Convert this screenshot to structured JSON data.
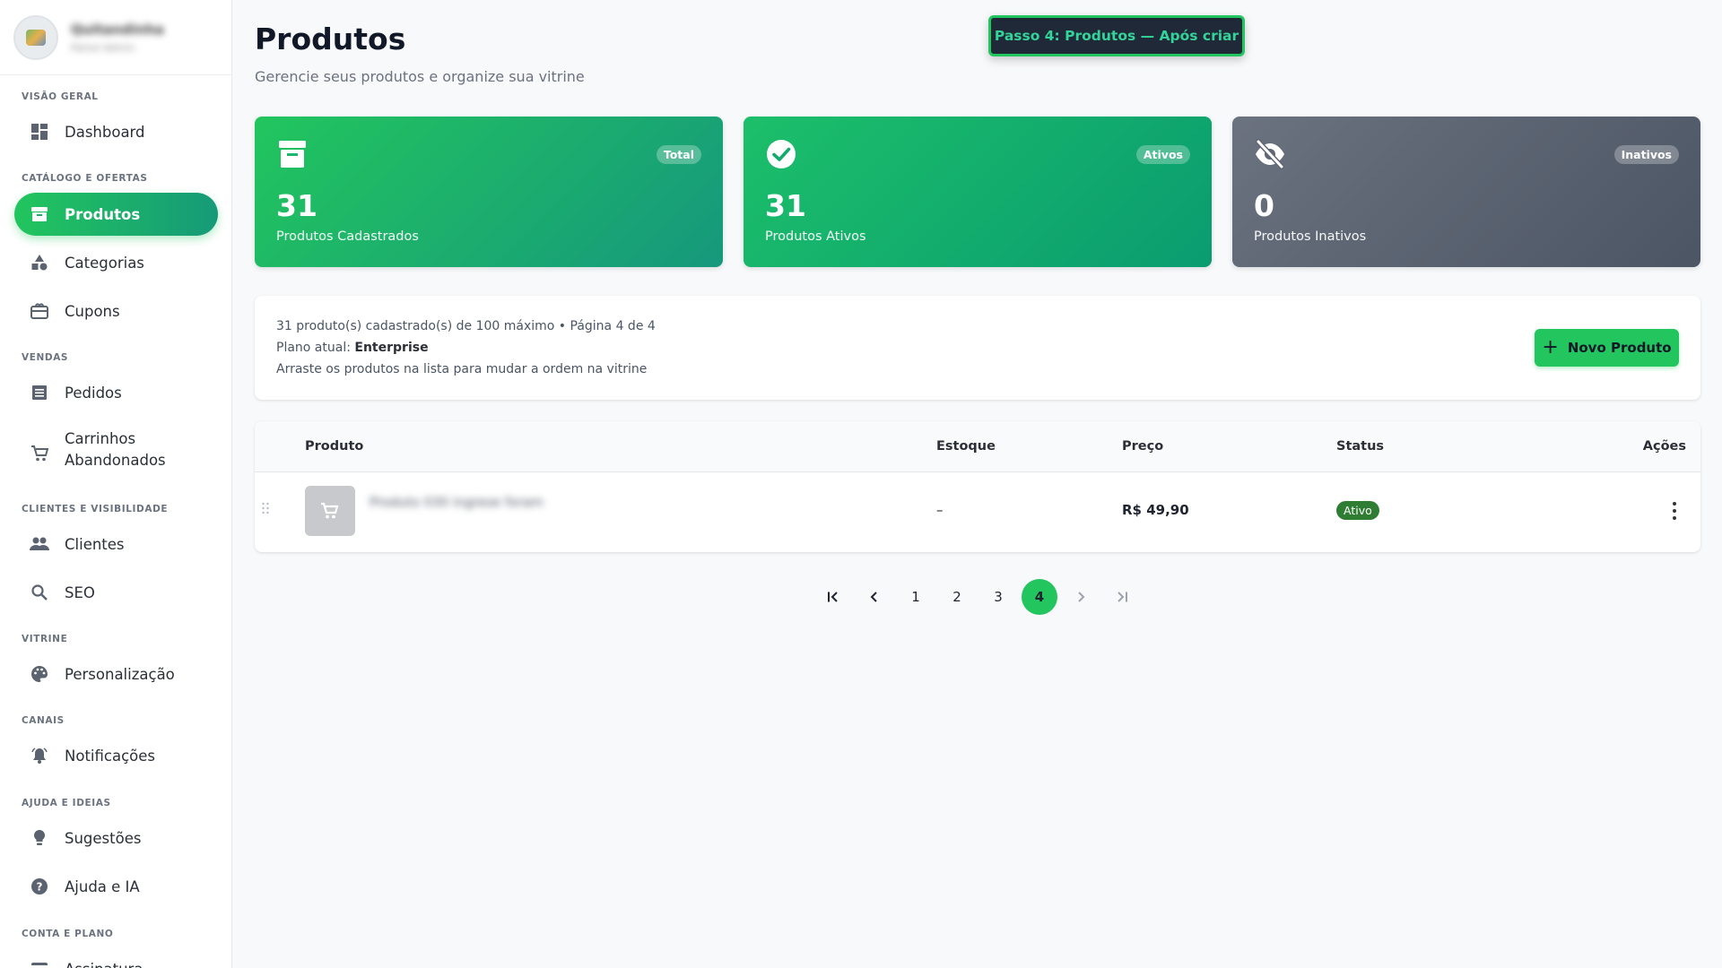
{
  "brand": {
    "name": "Quitandinha",
    "subtitle": "Painel Admin"
  },
  "sidebar": {
    "sections": {
      "overview": "VISÃO GERAL",
      "catalog": "CATÁLOGO E OFERTAS",
      "sales": "VENDAS",
      "clients": "CLIENTES E VISIBILIDADE",
      "showcase": "VITRINE",
      "channels": "CANAIS",
      "help": "AJUDA E IDEIAS",
      "account": "CONTA E PLANO"
    },
    "items": {
      "dashboard": "Dashboard",
      "products": "Produtos",
      "categories": "Categorias",
      "coupons": "Cupons",
      "orders": "Pedidos",
      "abandoned_carts_1": "Carrinhos",
      "abandoned_carts_2": "Abandonados",
      "clients": "Clientes",
      "seo": "SEO",
      "personalization": "Personalização",
      "notifications": "Notificações",
      "suggestions": "Sugestões",
      "help_ai": "Ajuda e IA",
      "subscription": "Assinatura"
    },
    "active_item": "products"
  },
  "header": {
    "title": "Produtos",
    "subtitle": "Gerencie seus produtos e organize sua vitrine",
    "step_banner": "Passo 4: Produtos — Após criar"
  },
  "stats": [
    {
      "badge": "Total",
      "value": "31",
      "label": "Produtos Cadastrados",
      "icon": "archive-icon"
    },
    {
      "badge": "Ativos",
      "value": "31",
      "label": "Produtos Ativos",
      "icon": "check-circle-icon"
    },
    {
      "badge": "Inativos",
      "value": "0",
      "label": "Produtos Inativos",
      "icon": "eye-off-icon"
    }
  ],
  "info": {
    "line1": "31 produto(s) cadastrado(s) de 100 máximo • Página 4 de 4",
    "plan_label": "Plano atual: ",
    "plan_value": "Enterprise",
    "line3": "Arraste os produtos na lista para mudar a ordem na vitrine",
    "new_button": "Novo Produto"
  },
  "table": {
    "columns": [
      "Produto",
      "Estoque",
      "Preço",
      "Status",
      "Ações"
    ],
    "rows": [
      {
        "name": "Produto 030 ingrese foram",
        "stock": "–",
        "price": "R$ 49,90",
        "status": "Ativo"
      }
    ]
  },
  "pagination": {
    "pages": [
      "1",
      "2",
      "3",
      "4"
    ],
    "current": "4"
  },
  "colors": {
    "accent": "#22c55e",
    "accent_dark": "#159a78",
    "inactive_card": "#5b6270",
    "status_active": "#2e7d32"
  }
}
